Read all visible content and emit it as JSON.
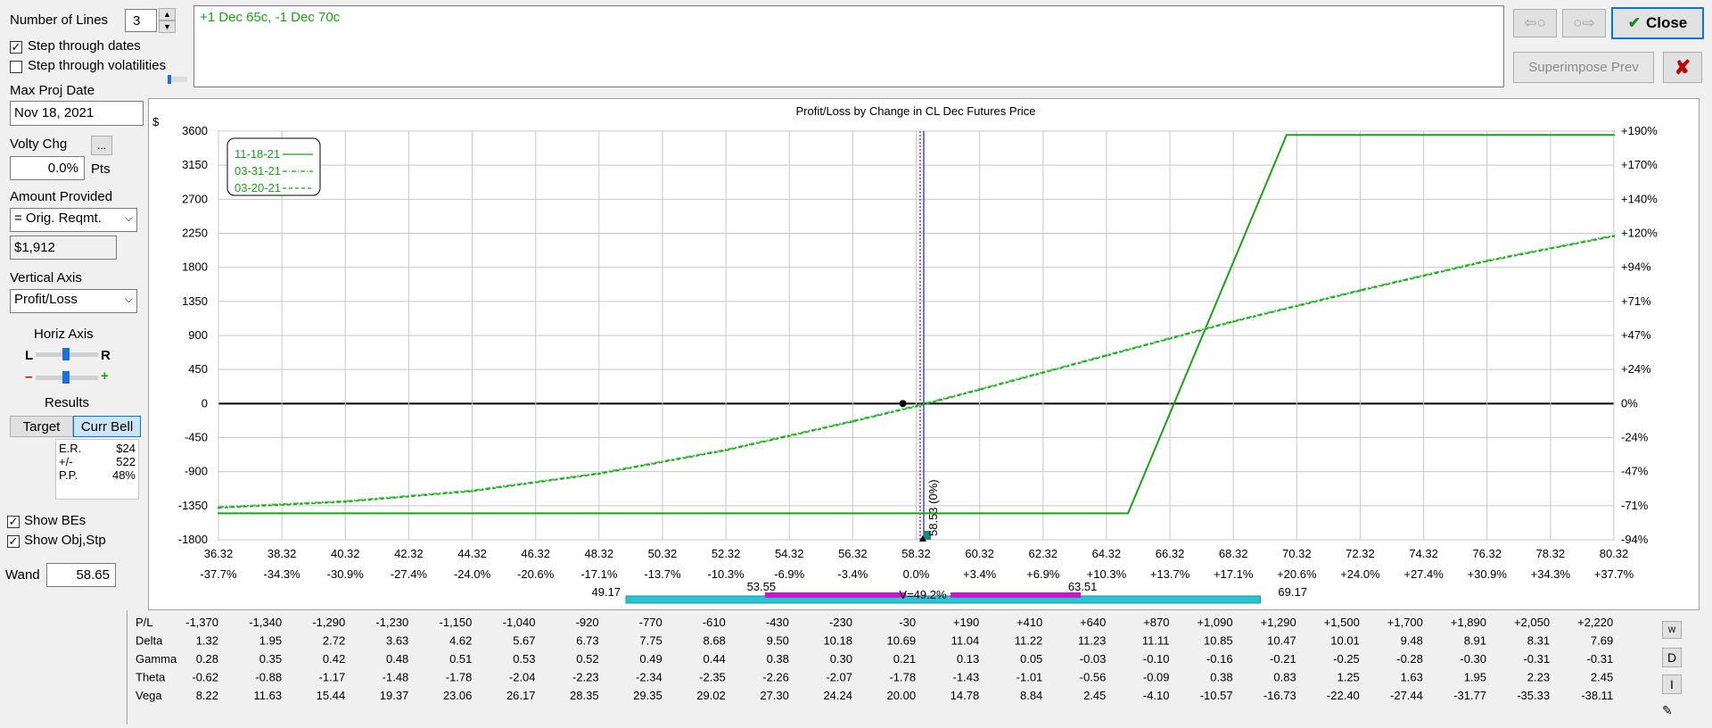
{
  "controls": {
    "num_lines_label": "Number of Lines",
    "num_lines_value": "3",
    "step_dates_label": "Step through dates",
    "step_dates_checked": true,
    "step_vols_label": "Step through volatilities",
    "step_vols_checked": false,
    "max_proj_date_label": "Max Proj Date",
    "max_proj_date_value": "Nov 18, 2021",
    "volty_chg_label": "Volty Chg",
    "volty_btn_label": "...",
    "volty_value": "0.0%",
    "volty_unit": "Pts",
    "amount_label": "Amount Provided",
    "amount_select": "= Orig. Reqmt.",
    "amount_value": "$1,912",
    "vaxis_label": "Vertical Axis",
    "vaxis_select": "Profit/Loss",
    "haxis_label": "Horiz Axis",
    "haxis_l": "L",
    "haxis_r": "R",
    "haxis_minus": "–",
    "haxis_plus": "+",
    "results_label": "Results",
    "target_btn": "Target",
    "currbell_btn": "Curr Bell",
    "stats": [
      {
        "k": "E.R.",
        "v": "$24"
      },
      {
        "k": "+/-",
        "v": "522"
      },
      {
        "k": "P.P.",
        "v": "48%"
      }
    ],
    "show_bes_label": "Show BEs",
    "show_bes_checked": true,
    "show_obj_label": "Show Obj,Stp",
    "show_obj_checked": true,
    "wand_label": "Wand",
    "wand_value": "58.65"
  },
  "position_text": "+1 Dec 65c, -1 Dec 70c",
  "toolbar": {
    "close_label": "Close",
    "superimpose_label": "Superimpose Prev",
    "back_arrow": "⇦○",
    "fwd_arrow": "○⇨",
    "delete_icon": "✘",
    "check_icon": "✔"
  },
  "colors": {
    "line_green": "#1aa01a",
    "line_light": "#33cc33",
    "bell_cyan": "#29c4d6",
    "bell_magenta": "#c020c0",
    "close_x": "#c00000"
  },
  "chart_data": {
    "type": "line",
    "title": "Profit/Loss by Change in CL Dec Futures Price",
    "ylabel": "$",
    "ylim": [
      -1800,
      3600
    ],
    "yticks": [
      "3600",
      "3150",
      "2700",
      "2250",
      "1800",
      "1350",
      "900",
      "450",
      "0",
      "-450",
      "-900",
      "-1350",
      "-1800"
    ],
    "yticks_right": [
      "+190%",
      "+170%",
      "+140%",
      "+120%",
      "+94%",
      "+71%",
      "+47%",
      "+24%",
      "0%",
      "-24%",
      "-47%",
      "-71%",
      "-94%"
    ],
    "xlim": [
      36.32,
      80.32
    ],
    "x_ticks": [
      "36.32",
      "38.32",
      "40.32",
      "42.32",
      "44.32",
      "46.32",
      "48.32",
      "50.32",
      "52.32",
      "54.32",
      "56.32",
      "58.32",
      "60.32",
      "62.32",
      "64.32",
      "66.32",
      "68.32",
      "70.32",
      "72.32",
      "74.32",
      "76.32",
      "78.32",
      "80.32"
    ],
    "x_pct": [
      "-37.7%",
      "-34.3%",
      "-30.9%",
      "-27.4%",
      "-24.0%",
      "-20.6%",
      "-17.1%",
      "-13.7%",
      "-10.3%",
      "-6.9%",
      "-3.4%",
      "0.0%",
      "+3.4%",
      "+6.9%",
      "+10.3%",
      "+13.7%",
      "+17.1%",
      "+20.6%",
      "+24.0%",
      "+27.4%",
      "+30.9%",
      "+34.3%",
      "+37.7%"
    ],
    "legend": [
      {
        "label": "11-18-21",
        "style": "solid"
      },
      {
        "label": "03-31-21",
        "style": "dashdot"
      },
      {
        "label": "03-20-21",
        "style": "dashed"
      }
    ],
    "series": [
      {
        "name": "11-18-21",
        "x": [
          36.32,
          65.0,
          70.0,
          80.32
        ],
        "y": [
          -1450,
          -1450,
          3550,
          3550
        ]
      },
      {
        "name": "03-31-21",
        "x": [
          36.32,
          40.32,
          44.32,
          48.32,
          52.32,
          56.32,
          58.32,
          60.32,
          64.32,
          68.32,
          72.32,
          76.32,
          80.32
        ],
        "y": [
          -1370,
          -1290,
          -1150,
          -920,
          -610,
          -230,
          -30,
          190,
          640,
          1090,
          1500,
          1890,
          2220
        ]
      },
      {
        "name": "03-20-21",
        "x": [
          36.32,
          40.32,
          44.32,
          48.32,
          52.32,
          56.32,
          58.32,
          60.32,
          64.32,
          68.32,
          72.32,
          76.32,
          80.32
        ],
        "y": [
          -1380,
          -1300,
          -1160,
          -930,
          -620,
          -240,
          -40,
          180,
          630,
          1080,
          1490,
          1880,
          2210
        ]
      }
    ],
    "current_price_label": "58.53 (0%)",
    "bell": {
      "labels": [
        "49.17",
        "53.55",
        "V=49.2%",
        "63.51",
        "69.17"
      ],
      "values": [
        49.17,
        53.55,
        63.51,
        69.17
      ]
    }
  },
  "table": {
    "row_labels": [
      "P/L",
      "Delta",
      "Gamma",
      "Theta",
      "Vega"
    ],
    "rows": [
      [
        "-1,370",
        "-1,340",
        "-1,290",
        "-1,230",
        "-1,150",
        "-1,040",
        "-920",
        "-770",
        "-610",
        "-430",
        "-230",
        "-30",
        "+190",
        "+410",
        "+640",
        "+870",
        "+1,090",
        "+1,290",
        "+1,500",
        "+1,700",
        "+1,890",
        "+2,050",
        "+2,220"
      ],
      [
        "1.32",
        "1.95",
        "2.72",
        "3.63",
        "4.62",
        "5.67",
        "6.73",
        "7.75",
        "8.68",
        "9.50",
        "10.18",
        "10.69",
        "11.04",
        "11.22",
        "11.23",
        "11.11",
        "10.85",
        "10.47",
        "10.01",
        "9.48",
        "8.91",
        "8.31",
        "7.69"
      ],
      [
        "0.28",
        "0.35",
        "0.42",
        "0.48",
        "0.51",
        "0.53",
        "0.52",
        "0.49",
        "0.44",
        "0.38",
        "0.30",
        "0.21",
        "0.13",
        "0.05",
        "-0.03",
        "-0.10",
        "-0.16",
        "-0.21",
        "-0.25",
        "-0.28",
        "-0.30",
        "-0.31",
        "-0.31"
      ],
      [
        "-0.62",
        "-0.88",
        "-1.17",
        "-1.48",
        "-1.78",
        "-2.04",
        "-2.23",
        "-2.34",
        "-2.35",
        "-2.26",
        "-2.07",
        "-1.78",
        "-1.43",
        "-1.01",
        "-0.56",
        "-0.09",
        "0.38",
        "0.83",
        "1.25",
        "1.63",
        "1.95",
        "2.23",
        "2.45"
      ],
      [
        "8.22",
        "11.63",
        "15.44",
        "19.37",
        "23.06",
        "26.17",
        "28.35",
        "29.35",
        "29.02",
        "27.30",
        "24.24",
        "20.00",
        "14.78",
        "8.84",
        "2.45",
        "-4.10",
        "-10.57",
        "-16.73",
        "-22.40",
        "-27.44",
        "-31.77",
        "-35.33",
        "-38.11"
      ]
    ],
    "side_buttons": [
      "W",
      "D",
      "I"
    ]
  }
}
